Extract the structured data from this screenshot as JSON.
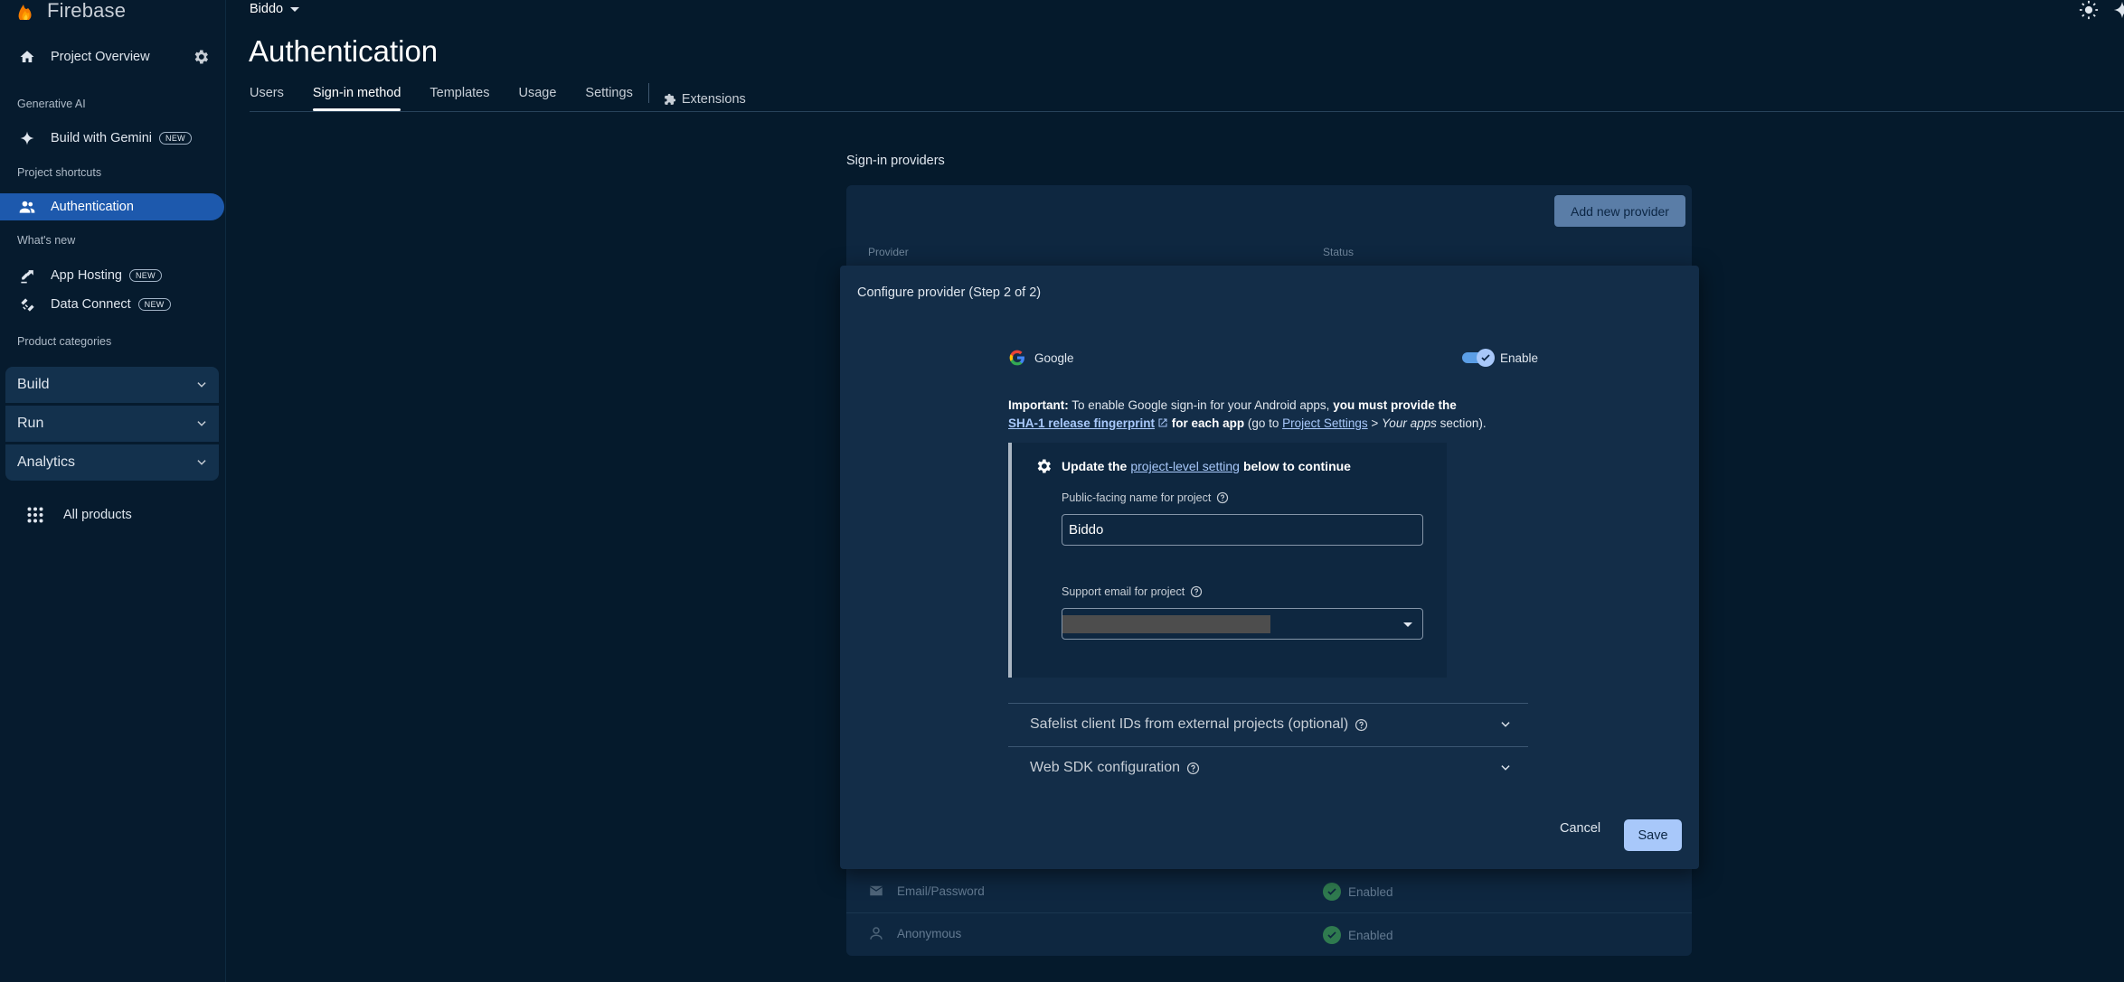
{
  "brand": {
    "name": "Firebase"
  },
  "sidebar": {
    "project_overview": "Project Overview",
    "sections": {
      "generative_ai": "Generative AI",
      "project_shortcuts": "Project shortcuts",
      "whats_new": "What's new",
      "product_categories": "Product categories"
    },
    "build_with_gemini": "Build with Gemini",
    "new_badge": "NEW",
    "authentication": "Authentication",
    "app_hosting": "App Hosting",
    "data_connect": "Data Connect",
    "categories": [
      "Build",
      "Run",
      "Analytics"
    ],
    "all_products": "All products"
  },
  "header": {
    "project": "Biddo",
    "title": "Authentication",
    "tabs": [
      "Users",
      "Sign-in method",
      "Templates",
      "Usage",
      "Settings"
    ],
    "active_tab": "Sign-in method",
    "extensions_tab": "Extensions"
  },
  "providers": {
    "section_title": "Sign-in providers",
    "add_button": "Add new provider",
    "col_provider": "Provider",
    "col_status": "Status",
    "rows": [
      {
        "name": "Email/Password",
        "status": "Enabled",
        "icon": "mail-icon"
      },
      {
        "name": "Anonymous",
        "status": "Enabled",
        "icon": "person-icon"
      }
    ]
  },
  "modal": {
    "title": "Configure provider (Step 2 of 2)",
    "provider_name": "Google",
    "enable_label": "Enable",
    "enabled": true,
    "important": {
      "lead": "Important:",
      "text1": " To enable Google sign-in for your Android apps, ",
      "bold1": "you must provide the",
      "link1": "SHA-1 release fingerprint",
      "bold2": " for each app",
      "text2": " (go to ",
      "link2": "Project Settings",
      "text3": " > ",
      "italic": "Your apps",
      "text4": " section)."
    },
    "update": {
      "prefix": "Update the",
      "link": "project-level setting",
      "suffix": "below to continue"
    },
    "public_name_label": "Public-facing name for project",
    "public_name_value": "Biddo",
    "support_email_label": "Support email for project",
    "safelist_label": "Safelist client IDs from external projects (optional)",
    "web_sdk_label": "Web SDK configuration",
    "cancel": "Cancel",
    "save": "Save"
  },
  "colors": {
    "background": "#051a2c",
    "active_nav": "#1d59ad",
    "primary_button": "#a8c8fa",
    "toggle_on": "#5b9ee6"
  }
}
